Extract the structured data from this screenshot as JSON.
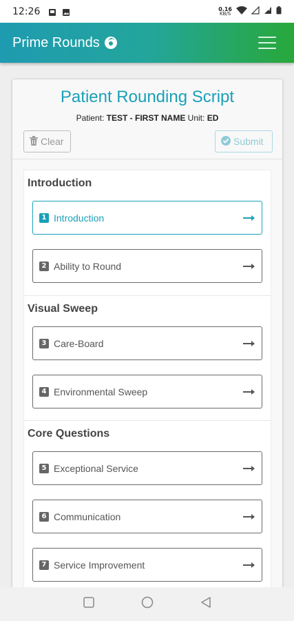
{
  "status_bar": {
    "time": "12:26",
    "net_speed_value": "0.16",
    "net_speed_unit": "KB/S"
  },
  "app_bar": {
    "title": "Prime Rounds",
    "logo_icon": "swirl-logo-icon",
    "menu_icon": "hamburger-menu-icon"
  },
  "header": {
    "title": "Patient Rounding Script",
    "patient_label": "Patient:",
    "patient_name": "TEST - FIRST NAME",
    "unit_label": "Unit:",
    "unit_value": "ED"
  },
  "actions": {
    "clear_label": "Clear",
    "submit_label": "Submit"
  },
  "sections": [
    {
      "title": "Introduction",
      "items": [
        {
          "number": "1",
          "label": "Introduction",
          "active": true
        },
        {
          "number": "2",
          "label": "Ability to Round",
          "active": false
        }
      ]
    },
    {
      "title": "Visual Sweep",
      "items": [
        {
          "number": "3",
          "label": "Care-Board",
          "active": false
        },
        {
          "number": "4",
          "label": "Environmental Sweep",
          "active": false
        }
      ]
    },
    {
      "title": "Core Questions",
      "items": [
        {
          "number": "5",
          "label": "Exceptional Service",
          "active": false
        },
        {
          "number": "6",
          "label": "Communication",
          "active": false
        },
        {
          "number": "7",
          "label": "Service Improvement",
          "active": false
        }
      ]
    }
  ],
  "colors": {
    "accent": "#1aa0b8",
    "gradient_start": "#1e9bb0",
    "gradient_end": "#28a83a"
  }
}
